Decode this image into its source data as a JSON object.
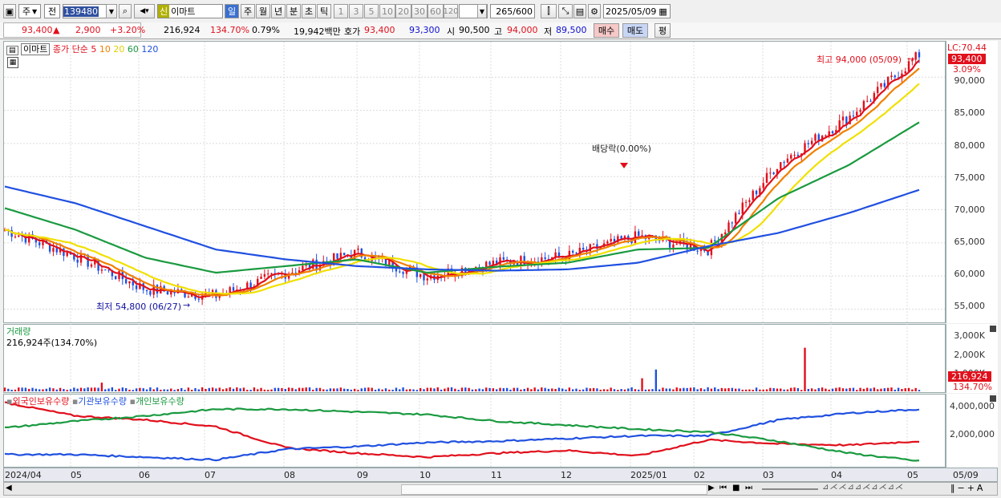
{
  "toolbar": {
    "market_label": "주",
    "scope_label": "전",
    "code": "139480",
    "new_badge": "신",
    "stock_name": "이마트",
    "period_tabs": [
      "일",
      "주",
      "월",
      "년",
      "분",
      "초",
      "틱"
    ],
    "interval_buttons": [
      "1",
      "3",
      "5",
      "10",
      "20",
      "30",
      "60",
      "120"
    ],
    "count_value": "265",
    "count_total": "/600",
    "date": "2025/05/09"
  },
  "quote": {
    "price": "93,400",
    "change": "2,900",
    "change_pct": "+3.20%",
    "volume": "216,924",
    "volume_ratio": "134.70%",
    "turnover": "0.79%",
    "amount": "19,942백만",
    "ask_label": "호가",
    "ask": "93,400",
    "bid": "93,300",
    "open_label": "시",
    "open": "90,500",
    "high_label": "고",
    "high": "94,000",
    "low_label": "저",
    "low": "89,500",
    "buy_label": "매수",
    "sell_label": "매도",
    "eval_label": "평"
  },
  "price_panel": {
    "stock_tag": "이마트",
    "legend_prefix": "종가 단순",
    "ma_labels": [
      "5",
      "10",
      "20",
      "60",
      "120"
    ],
    "ma_colors": [
      "#e0101c",
      "#f08000",
      "#f0e000",
      "#1a9a40",
      "#2050e0"
    ],
    "lc_label": "LC:70.44",
    "current_tag": "93,400",
    "current_pct": "3.09%",
    "y_ticks": [
      "90,000",
      "85,000",
      "80,000",
      "75,000",
      "70,000",
      "65,000",
      "60,000",
      "55,000"
    ],
    "high_annotation": "최고 94,000 (05/09)",
    "low_annotation": "최저 54,800 (06/27)",
    "dividend_annotation": "배당락(0.00%)"
  },
  "volume_panel": {
    "title": "거래량",
    "subtitle": "216,924주(134.70%)",
    "y_ticks": [
      "3,000K",
      "2,000K",
      "1,000K"
    ],
    "current_tag": "216,924",
    "current_pct": "134.70%"
  },
  "holdings_panel": {
    "legend": [
      "외국인보유수량",
      "기관보유수량",
      "개인보유수량"
    ],
    "legend_colors": [
      "#e0101c",
      "#2050e0",
      "#1a9a40"
    ],
    "y_ticks": [
      "4,000,000",
      "2,000,000"
    ]
  },
  "x_axis": [
    "2024/04",
    "05",
    "06",
    "07",
    "08",
    "09",
    "10",
    "11",
    "12",
    "2025/01",
    "02",
    "03",
    "04",
    "05",
    "05/09"
  ],
  "chart_data": {
    "type": "line",
    "title": "",
    "x": [
      "2024/04",
      "05",
      "06",
      "07",
      "08",
      "09",
      "10",
      "11",
      "12",
      "2025/01",
      "02",
      "03",
      "04",
      "05"
    ],
    "price_close_approx": [
      67000,
      63000,
      58000,
      57000,
      60500,
      63500,
      60000,
      62000,
      63000,
      66000,
      64000,
      77000,
      84000,
      93400
    ],
    "ylim": [
      53000,
      95000
    ],
    "series": [
      {
        "name": "5",
        "values": [
          66500,
          63200,
          57500,
          57200,
          61000,
          63800,
          59500,
          62000,
          63500,
          66500,
          64000,
          79000,
          83500,
          91500
        ]
      },
      {
        "name": "120",
        "values": [
          73500,
          71000,
          67500,
          64000,
          62500,
          61500,
          61000,
          60800,
          61000,
          62000,
          64500,
          66500,
          69500,
          73000
        ]
      }
    ],
    "volume_ylim": [
      0,
      3200000
    ],
    "holdings_series": [
      {
        "name": "외국인보유수량",
        "values": [
          4700000,
          3700000,
          3400000,
          2900000,
          1300000,
          900000,
          600000,
          900000,
          1100000,
          700000,
          1900000,
          1600000,
          1500000,
          1800000
        ]
      },
      {
        "name": "기관보유수량",
        "values": [
          800000,
          800000,
          600000,
          400000,
          1200000,
          1400000,
          1700000,
          1800000,
          2000000,
          2200000,
          2200000,
          3400000,
          3900000,
          4200000
        ]
      },
      {
        "name": "개인보유수량",
        "values": [
          2800000,
          3300000,
          3700000,
          4200000,
          4200000,
          4000000,
          3800000,
          3300000,
          3000000,
          2700000,
          2500000,
          1800000,
          900000,
          300000
        ]
      }
    ]
  }
}
